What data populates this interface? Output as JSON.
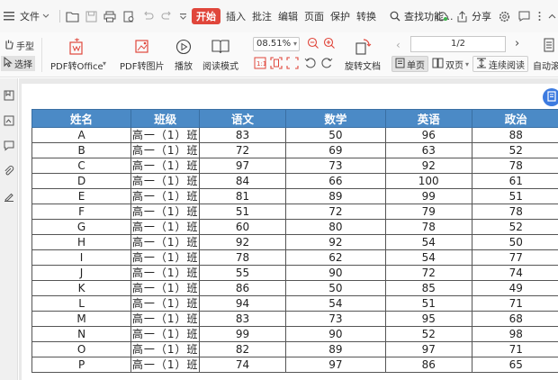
{
  "menubar": {
    "file_label": "文件",
    "start_tab": "开始",
    "tabs": [
      "插入",
      "批注",
      "编辑",
      "页面",
      "保护",
      "转换"
    ],
    "search_label": "查找功能...",
    "share_label": "分享"
  },
  "ribbon": {
    "hand_label": "手型",
    "select_label": "选择",
    "pdf_to_office": "PDF转Office",
    "pdf_to_image": "PDF转图片",
    "play_label": "播放",
    "read_mode": "阅读模式",
    "zoom_value": "08.51%",
    "rotate_doc": "旋转文档",
    "page_indicator": "1/2",
    "single_page": "单页",
    "double_page": "双页",
    "continuous_read": "连续阅读",
    "auto_scroll": "自动滚"
  },
  "table": {
    "headers": [
      "姓名",
      "班级",
      "语文",
      "数学",
      "英语",
      "政治"
    ],
    "rows": [
      [
        "A",
        "高一（1）班",
        "83",
        "50",
        "96",
        "88"
      ],
      [
        "B",
        "高一（1）班",
        "72",
        "69",
        "63",
        "52"
      ],
      [
        "C",
        "高一（1）班",
        "97",
        "73",
        "92",
        "78"
      ],
      [
        "D",
        "高一（1）班",
        "84",
        "66",
        "100",
        "61"
      ],
      [
        "E",
        "高一（1）班",
        "81",
        "89",
        "99",
        "51"
      ],
      [
        "F",
        "高一（1）班",
        "51",
        "72",
        "79",
        "78"
      ],
      [
        "G",
        "高一（1）班",
        "60",
        "80",
        "78",
        "52"
      ],
      [
        "H",
        "高一（1）班",
        "92",
        "92",
        "54",
        "50"
      ],
      [
        "I",
        "高一（1）班",
        "78",
        "62",
        "54",
        "77"
      ],
      [
        "J",
        "高一（1）班",
        "55",
        "90",
        "72",
        "74"
      ],
      [
        "K",
        "高一（1）班",
        "86",
        "50",
        "85",
        "49"
      ],
      [
        "L",
        "高一（1）班",
        "94",
        "54",
        "51",
        "71"
      ],
      [
        "M",
        "高一（1）班",
        "83",
        "73",
        "95",
        "68"
      ],
      [
        "N",
        "高一（1）班",
        "99",
        "90",
        "52",
        "98"
      ],
      [
        "O",
        "高一（1）班",
        "82",
        "89",
        "97",
        "71"
      ],
      [
        "P",
        "高一（1）班",
        "74",
        "97",
        "86",
        "65"
      ]
    ]
  },
  "colors": {
    "header_blue": "#4b8ac6",
    "start_red": "#e0463b",
    "float_blue": "#3d7be0"
  }
}
